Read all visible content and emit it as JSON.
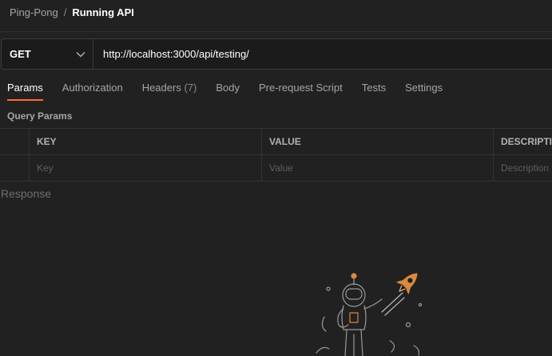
{
  "breadcrumb": {
    "parent": "Ping-Pong",
    "separator": "/",
    "current": "Running API"
  },
  "request": {
    "method": "GET",
    "url": "http://localhost:3000/api/testing/"
  },
  "tabs": [
    {
      "label": "Params",
      "active": true
    },
    {
      "label": "Authorization"
    },
    {
      "label": "Headers",
      "count": "(7)"
    },
    {
      "label": "Body"
    },
    {
      "label": "Pre-request Script"
    },
    {
      "label": "Tests"
    },
    {
      "label": "Settings"
    }
  ],
  "query_params": {
    "title": "Query Params",
    "columns": {
      "key": "KEY",
      "value": "VALUE",
      "description": "DESCRIPTION"
    },
    "placeholders": {
      "key": "Key",
      "value": "Value",
      "description": "Description"
    }
  },
  "response": {
    "label": "Response",
    "illustration_icon": "astronaut-rocket-illustration"
  },
  "colors": {
    "accent": "#ff6c37",
    "background": "#212121"
  }
}
